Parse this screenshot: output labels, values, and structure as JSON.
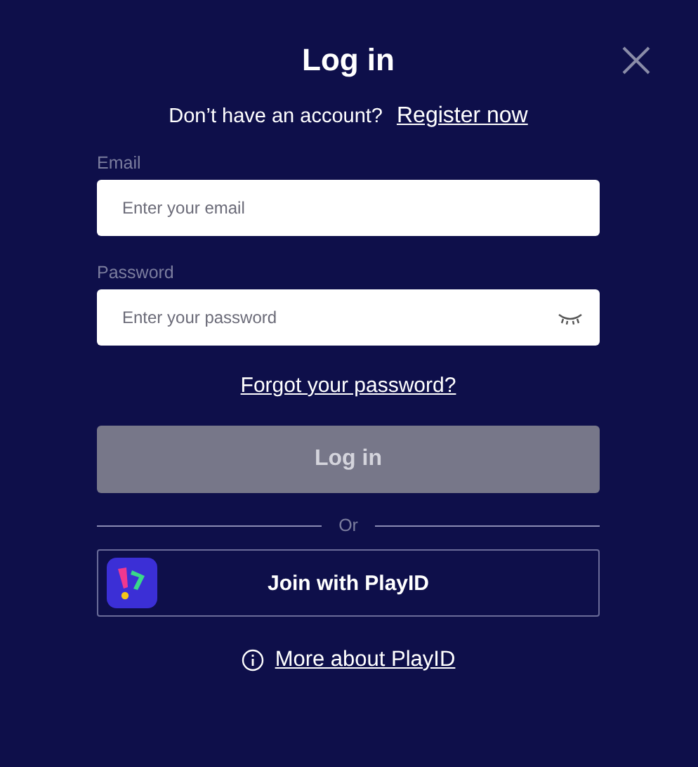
{
  "title": "Log in",
  "register": {
    "prompt": "Don’t have an account?",
    "link": "Register now"
  },
  "fields": [
    {
      "label": "Email",
      "placeholder": "Enter your email",
      "kind": "text"
    },
    {
      "label": "Password",
      "placeholder": "Enter your password",
      "kind": "password"
    }
  ],
  "forgot_link": "Forgot your password?",
  "login_button": {
    "label": "Log in",
    "disabled": true
  },
  "divider": "Or",
  "playid_button": "Join with PlayID",
  "more_link": "More about PlayID"
}
